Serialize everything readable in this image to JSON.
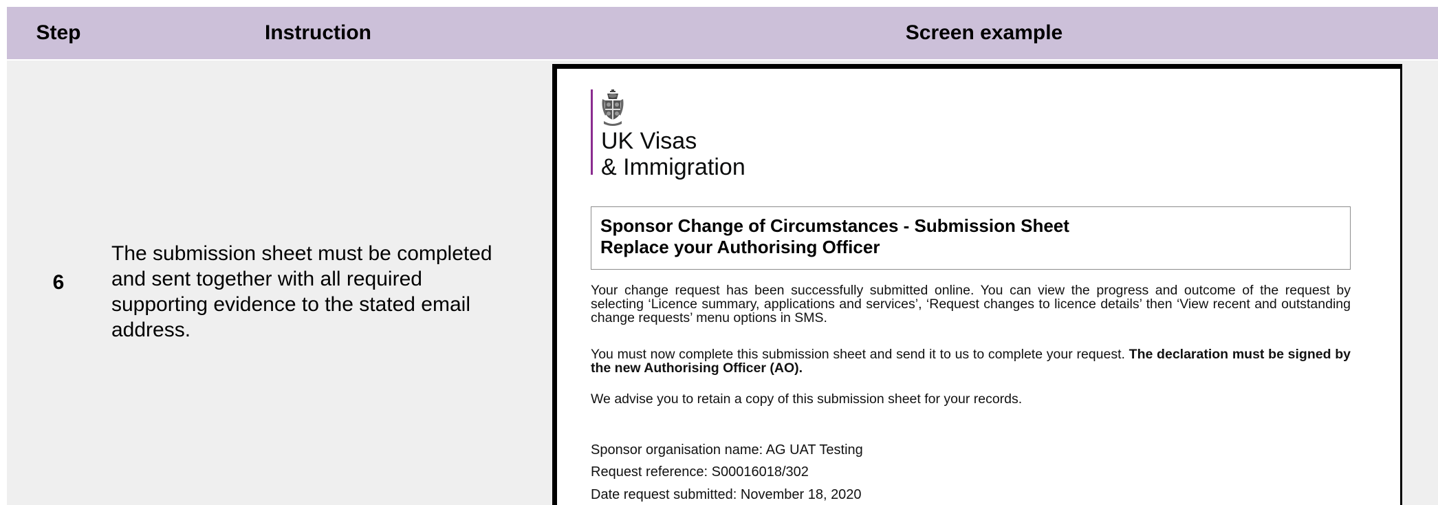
{
  "header": {
    "step": "Step",
    "instruction": "Instruction",
    "screen_example": "Screen example"
  },
  "row": {
    "step": "6",
    "instruction": "The submission sheet must be completed and sent together with all required supporting evidence to the stated email address."
  },
  "screen": {
    "logo": {
      "line1": "UK Visas",
      "line2": "& Immigration",
      "crest_icon": "royal-crest-icon",
      "accent_color": "#8a2c8f"
    },
    "title_line1": "Sponsor Change of Circumstances - Submission Sheet",
    "title_line2": "Replace your Authorising Officer",
    "para1": "Your change request has been successfully submitted online. You can view the progress and outcome of the request by selecting ‘Licence summary, applications and services’, ‘Request changes to licence details’ then ‘View recent and outstanding change requests’ menu options in SMS.",
    "para2_normal": "You must now complete this submission sheet and send it to us to complete your request. ",
    "para2_bold": "The declaration must be signed by the new Authorising Officer (AO).",
    "para3": "We advise you to retain a copy of this submission sheet for your records.",
    "sponsor_name": "Sponsor organisation name: AG UAT Testing",
    "request_reference": "Request reference: S00016018/302",
    "date_submitted": "Date request submitted: November 18, 2020"
  },
  "colors": {
    "header_bg": "#ccc0d9",
    "row_bg": "#efefef"
  }
}
